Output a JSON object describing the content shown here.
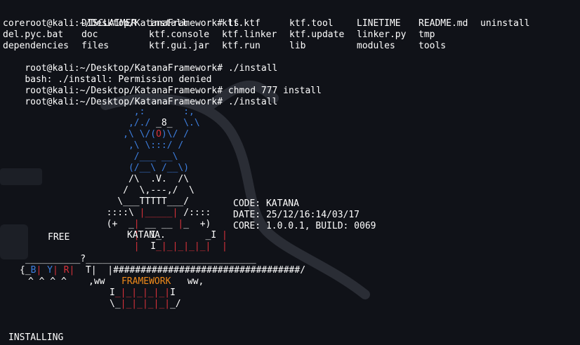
{
  "terminal": {
    "prompt": "root@kali:~/Desktop/KatanaFramework#",
    "commands": [
      " ls",
      " ./install",
      " chmod 777 install",
      " ./install"
    ],
    "ls_rows": [
      [
        "core",
        "DISCLAIMER",
        "install",
        "ktf.ktf",
        "ktf.tool",
        "LINETIME",
        "README.md",
        "uninstall"
      ],
      [
        "del.pyc.bat",
        "doc",
        "ktf.console",
        "ktf.linker",
        "ktf.update",
        "linker.py",
        "tmp"
      ],
      [
        "dependencies",
        "files",
        "ktf.gui.jar",
        "ktf.run",
        "lib",
        "modules",
        "tools"
      ]
    ],
    "error_line": "bash: ./install: Permission denied"
  },
  "banner": {
    "code": "CODE: KATANA",
    "date": "DATE: 25/12/16:14/03/17",
    "core": "CORE: 1.0.0.1, BUILD: 0069",
    "free": "FREE",
    "katana": "KATANA.",
    "framework": "FRAMEWORK",
    "byr_b": "B",
    "byr_y": "Y",
    "byr_r": "R",
    "progress_bar": "##################################"
  },
  "status": "INSTALLING",
  "colors": {
    "background": "#101218",
    "blue": "#3d7fe0",
    "red": "#d8313a",
    "orange": "#f08a1a"
  }
}
